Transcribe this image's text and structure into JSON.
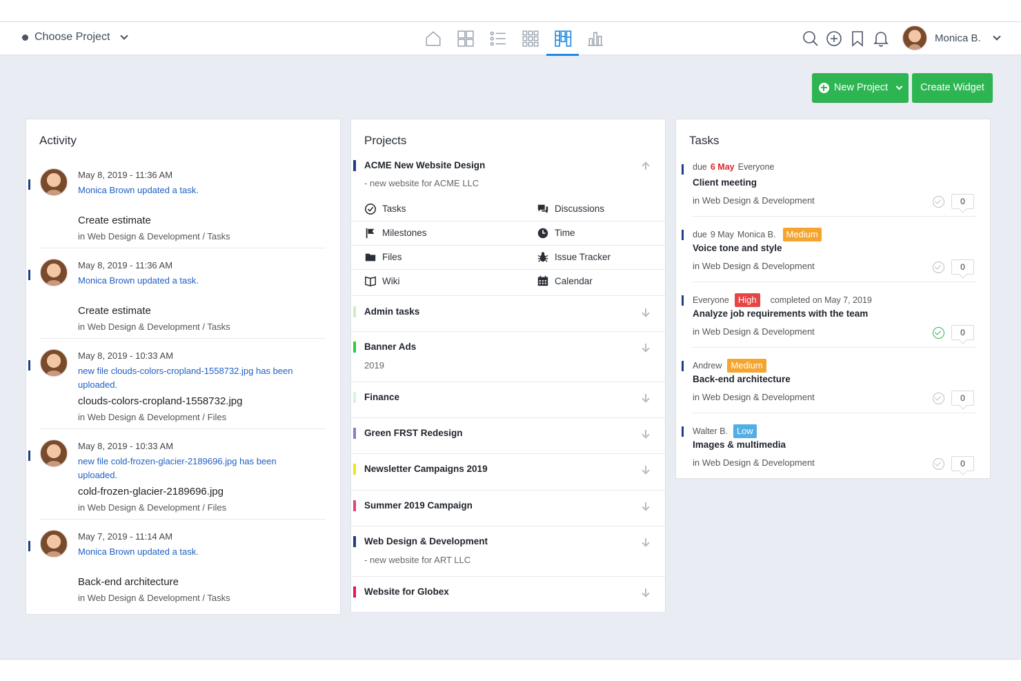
{
  "topbar": {
    "project_chooser": "Choose Project",
    "nav": [
      "home-icon",
      "dashboard-icon",
      "list-icon",
      "grid-icon",
      "board-icon",
      "chart-icon"
    ],
    "active_nav": "board-icon",
    "user_name": "Monica B."
  },
  "buttons": {
    "new_project": "New Project",
    "create_widget": "Create Widget"
  },
  "colors": {
    "accent": "#1e88e5",
    "primary_button": "#2db552",
    "link": "#1f5fc4",
    "due_red": "#e02424",
    "badge_medium": "#f5a52e",
    "badge_high": "#e54545",
    "badge_low": "#54aee6"
  },
  "activity": {
    "title": "Activity",
    "items": [
      {
        "date": "May 8, 2019 - 11:36 AM",
        "action": "Monica Brown updated a task.",
        "title": "Create estimate",
        "sub": "in Web Design & Development / Tasks"
      },
      {
        "date": "May 8, 2019 - 11:36 AM",
        "action": "Monica Brown updated a task.",
        "title": "Create estimate",
        "sub": "in Web Design & Development / Tasks"
      },
      {
        "date": "May 8, 2019 - 10:33 AM",
        "action": "new file clouds-colors-cropland-1558732.jpg has been uploaded.",
        "title": "clouds-colors-cropland-1558732.jpg",
        "sub": "in Web Design & Development / Files"
      },
      {
        "date": "May 8, 2019 - 10:33 AM",
        "action": "new file cold-frozen-glacier-2189696.jpg has been uploaded.",
        "title": "cold-frozen-glacier-2189696.jpg",
        "sub": "in Web Design & Development / Files"
      },
      {
        "date": "May 7, 2019 - 11:14 AM",
        "action": "Monica Brown updated a task.",
        "title": "Back-end architecture",
        "sub": "in Web Design & Development / Tasks"
      }
    ]
  },
  "projects": {
    "title": "Projects",
    "expanded": {
      "name": "ACME New Website Design",
      "desc": "- new website for ACME LLC",
      "tools": [
        "Tasks",
        "Discussions",
        "Milestones",
        "Time",
        "Files",
        "Issue Tracker",
        "Wiki",
        "Calendar"
      ]
    },
    "items": [
      {
        "name": "Admin tasks",
        "desc": "",
        "color": "#cfeec0"
      },
      {
        "name": "Banner Ads",
        "desc": "2019",
        "color": "#2ecc40"
      },
      {
        "name": "Finance",
        "desc": "",
        "color": "#d6f5de"
      },
      {
        "name": "Green FRST Redesign",
        "desc": "",
        "color": "#8e7cc3"
      },
      {
        "name": "Newsletter Campaigns 2019",
        "desc": "",
        "color": "#f2e41c"
      },
      {
        "name": "Summer 2019 Campaign",
        "desc": "",
        "color": "#e0457b"
      },
      {
        "name": "Web Design & Development",
        "desc": "- new website for ART LLC",
        "color": "#1e3f86"
      },
      {
        "name": "Website for Globex",
        "desc": "",
        "color": "#e8174f"
      }
    ]
  },
  "tasks": {
    "title": "Tasks",
    "items": [
      {
        "due_prefix": "due",
        "due_date": "6 May",
        "assignee": "Everyone",
        "badge": "",
        "completed": "",
        "title": "Client meeting",
        "sub": "in Web Design & Development",
        "count": "0"
      },
      {
        "due_prefix": "due",
        "due_date": "9 May",
        "assignee": "Monica B.",
        "badge": "Medium",
        "completed": "",
        "title": "Voice tone and style",
        "sub": "in Web Design & Development",
        "count": "0"
      },
      {
        "due_prefix": "",
        "due_date": "",
        "assignee": "Everyone",
        "badge": "High",
        "completed": "completed on May 7, 2019",
        "title": "Analyze job requirements with the team",
        "sub": "in Web Design & Development",
        "count": "0"
      },
      {
        "due_prefix": "",
        "due_date": "",
        "assignee": "Andrew",
        "badge": "Medium",
        "completed": "",
        "title": "Back-end architecture",
        "sub": "in Web Design & Development",
        "count": "0"
      },
      {
        "due_prefix": "",
        "due_date": "",
        "assignee": "Walter B.",
        "badge": "Low",
        "completed": "",
        "title": "Images & multimedia",
        "sub": "in Web Design & Development",
        "count": "0"
      }
    ]
  }
}
